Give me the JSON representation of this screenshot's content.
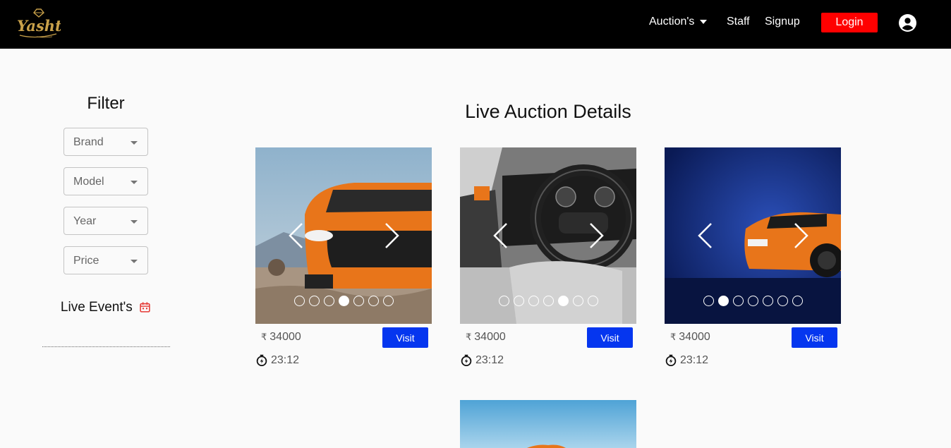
{
  "nav": {
    "auctions": "Auction's",
    "staff": "Staff",
    "signup": "Signup",
    "login": "Login"
  },
  "filter": {
    "title": "Filter",
    "selects": [
      "Brand",
      "Model",
      "Year",
      "Price"
    ],
    "live_events": "Live Event's"
  },
  "main": {
    "title": "Live Auction Details"
  },
  "cards": [
    {
      "price": "34000",
      "rupee": "₹",
      "visit": "Visit",
      "time": "23:12",
      "active_dot": 4,
      "dot_count": 7
    },
    {
      "price": "34000",
      "rupee": "₹",
      "visit": "Visit",
      "time": "23:12",
      "active_dot": 5,
      "dot_count": 7
    },
    {
      "price": "34000",
      "rupee": "₹",
      "visit": "Visit",
      "time": "23:12",
      "active_dot": 2,
      "dot_count": 7
    }
  ],
  "colors": {
    "navbar": "#000000",
    "login": "#ff0000",
    "visit": "#0536ef",
    "logo_gold": "#c9a14a",
    "live_events_icon": "#e53935"
  },
  "icons": {
    "logo": "yashti-logo",
    "account": "account-circle-icon",
    "calendar": "calendar-icon",
    "timer": "timer-icon",
    "prev": "chevron-left-icon",
    "next": "chevron-right-icon"
  }
}
